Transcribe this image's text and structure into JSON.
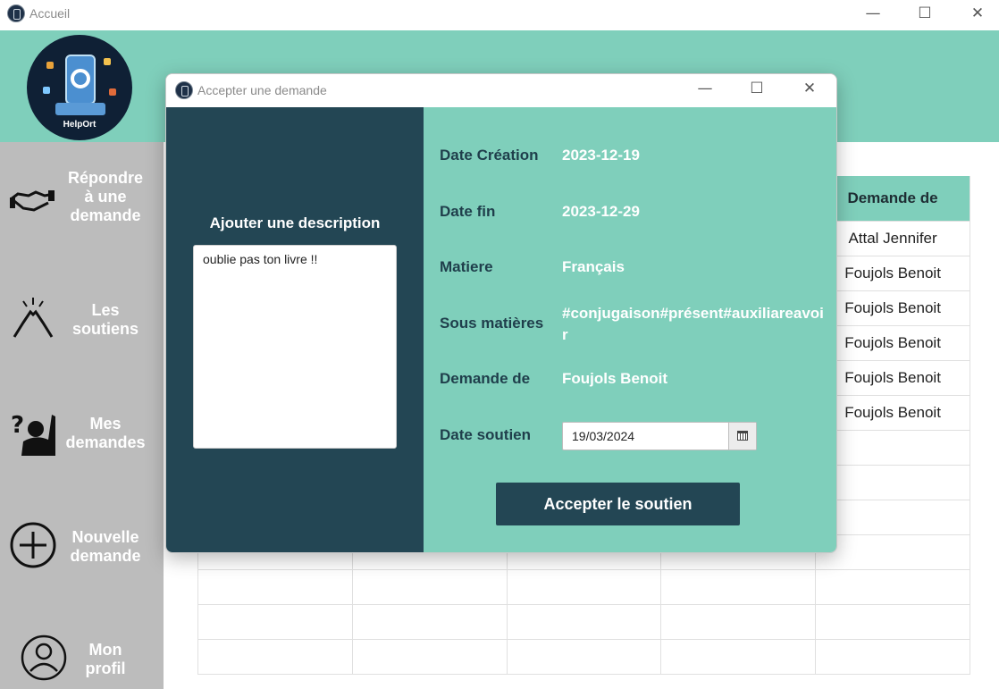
{
  "window": {
    "title": "Accueil",
    "controls": {
      "minimize": "—",
      "maximize": "☐",
      "close": "✕"
    }
  },
  "logo": {
    "text": "HelpOrt"
  },
  "sidebar": {
    "items": [
      {
        "line1": "Répondre",
        "line2": "à une",
        "line3": "demande",
        "icon": "handshake-icon"
      },
      {
        "line1": "Les",
        "line2": "soutiens",
        "icon": "high-five-icon"
      },
      {
        "line1": "Mes",
        "line2": "demandes",
        "icon": "question-person-icon"
      },
      {
        "line1": "Nouvelle",
        "line2": "demande",
        "icon": "plus-circle-icon"
      },
      {
        "line1": "Mon",
        "line2": "profil",
        "icon": "user-circle-icon"
      }
    ]
  },
  "table": {
    "visible_header": "Demande de",
    "rows": [
      "Attal Jennifer",
      "Foujols Benoit",
      "Foujols Benoit",
      "Foujols Benoit",
      "Foujols Benoit",
      "Foujols Benoit",
      "",
      "",
      "",
      "",
      "",
      "",
      ""
    ]
  },
  "dialog": {
    "title": "Accepter une demande",
    "controls": {
      "minimize": "—",
      "maximize": "☐",
      "close": "✕"
    },
    "description_label": "Ajouter une description",
    "description_value": "oublie pas ton livre !!",
    "fields": {
      "date_creation_label": "Date Création",
      "date_creation_value": "2023-12-19",
      "date_fin_label": "Date fin",
      "date_fin_value": "2023-12-29",
      "matiere_label": "Matiere",
      "matiere_value": "Français",
      "sous_matieres_label": "Sous matières",
      "sous_matieres_value": "#conjugaison#présent#auxiliareavoir",
      "demande_de_label": "Demande de",
      "demande_de_value": "Foujols Benoit",
      "date_soutien_label": "Date soutien",
      "date_soutien_value": "19/03/2024"
    },
    "accept_button": "Accepter le soutien"
  },
  "colors": {
    "accent_teal": "#7fcfbb",
    "dark_teal": "#234654",
    "sidebar_gray": "#bcbcbc"
  }
}
